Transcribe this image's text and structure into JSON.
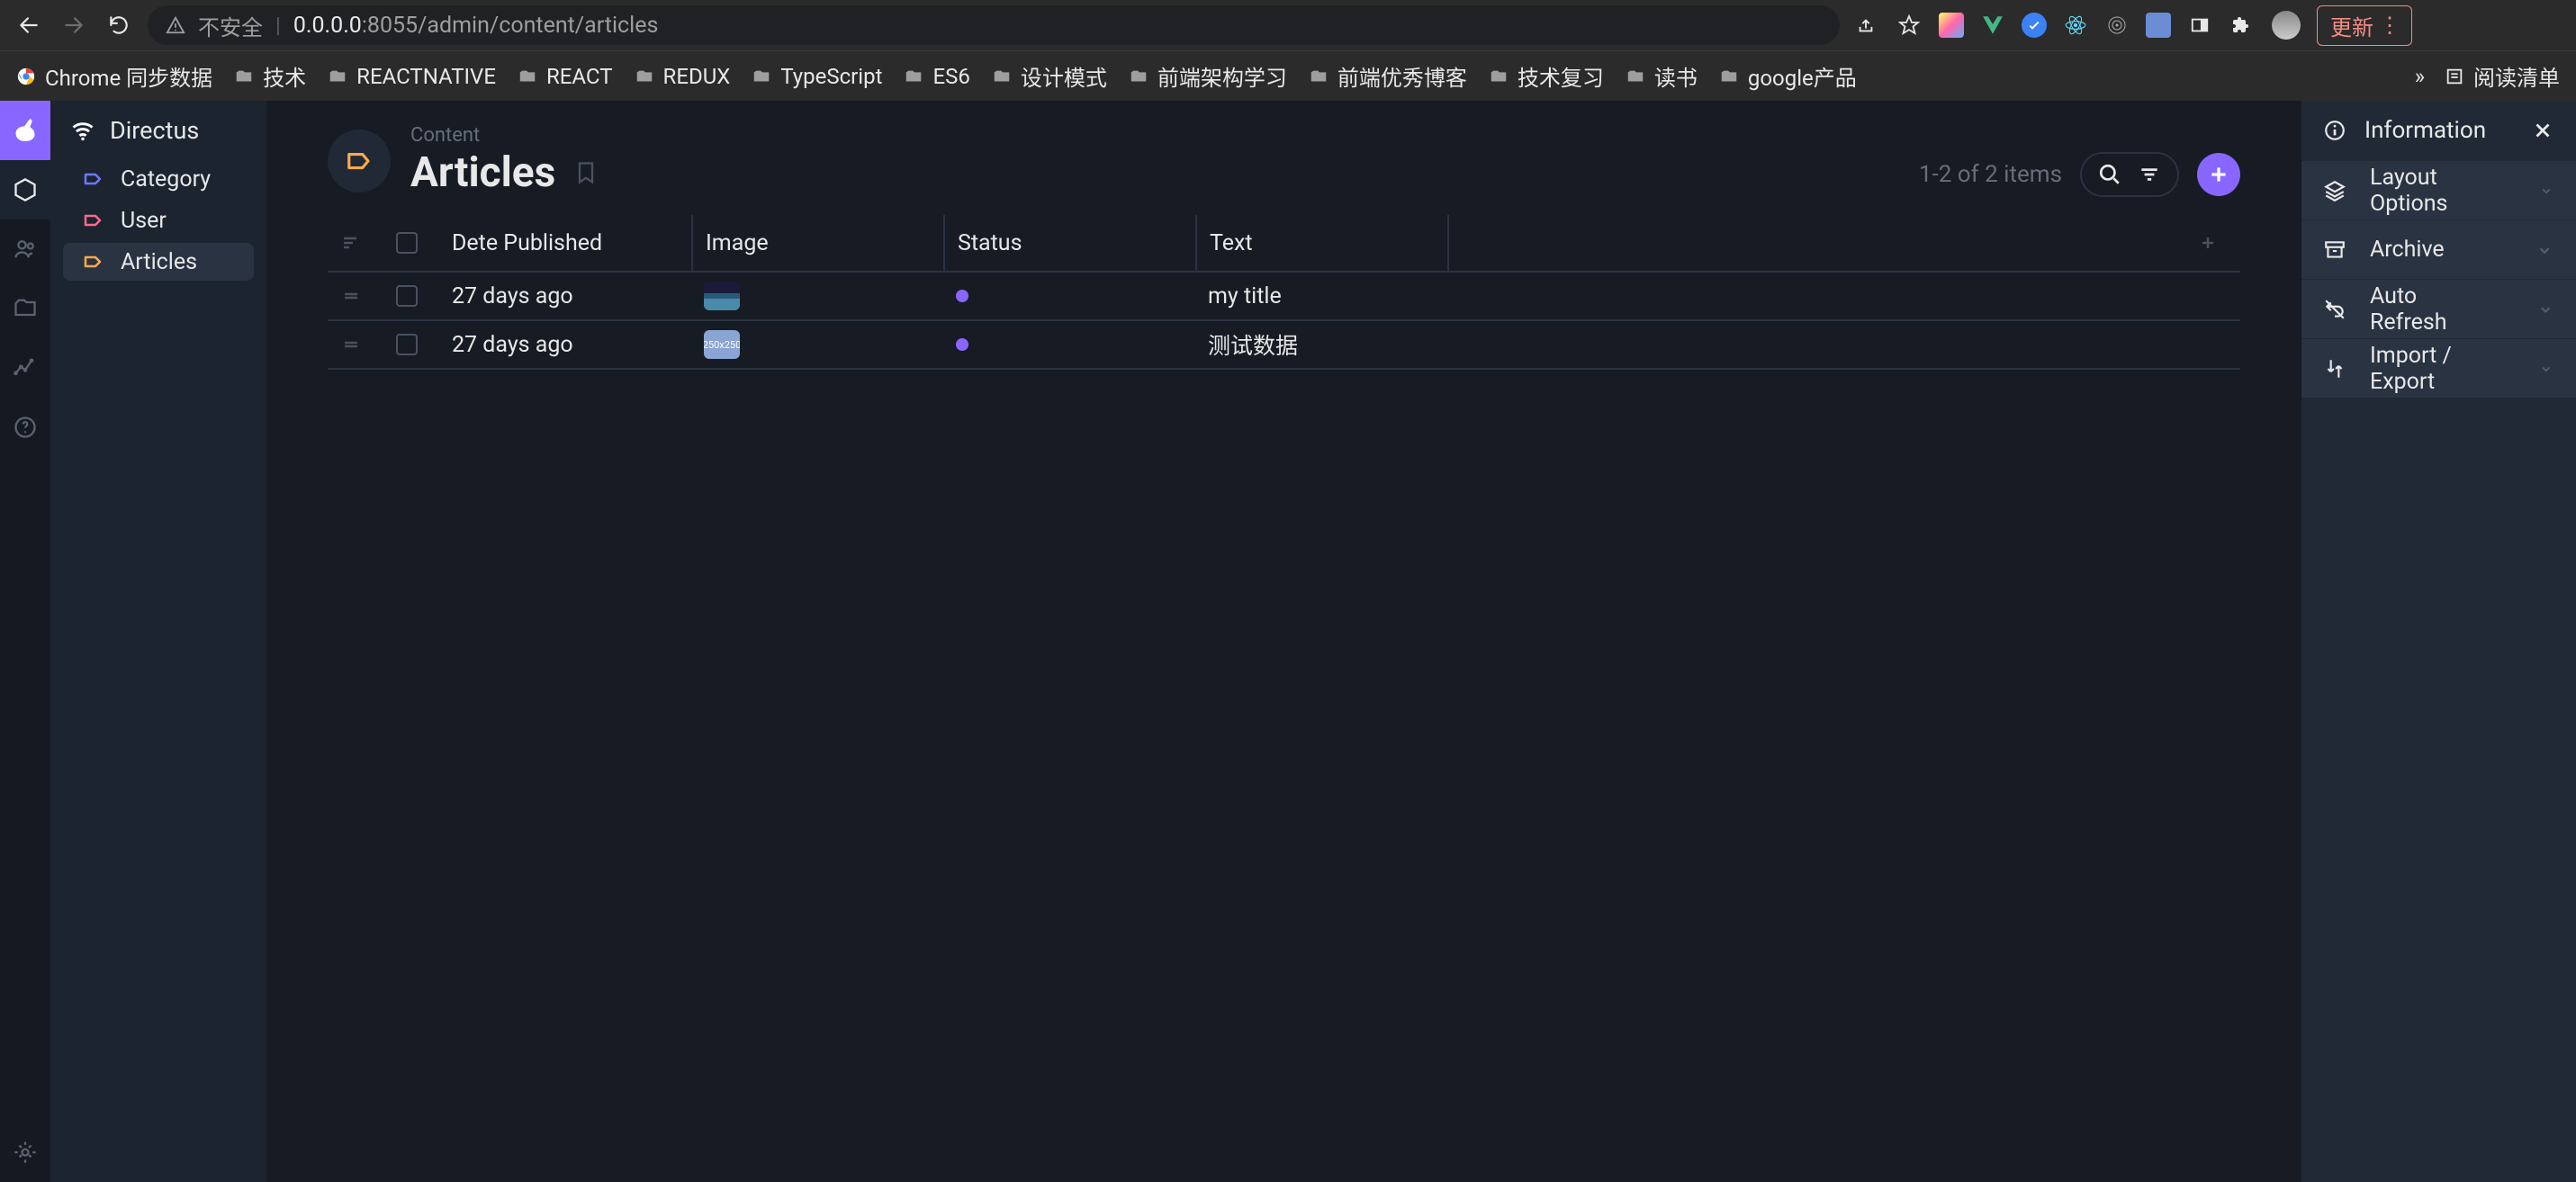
{
  "browser": {
    "insecure_label": "不安全",
    "domain": "0.0.0.0",
    "port_path": ":8055/admin/content/articles",
    "update_label": "更新",
    "bookmarks_more": "»",
    "reading_list": "阅读清单",
    "bookmarks": [
      {
        "label": "Chrome 同步数据",
        "type": "chrome"
      },
      {
        "label": "技术",
        "type": "folder"
      },
      {
        "label": "REACTNATIVE",
        "type": "folder"
      },
      {
        "label": "REACT",
        "type": "folder"
      },
      {
        "label": "REDUX",
        "type": "folder"
      },
      {
        "label": "TypeScript",
        "type": "folder"
      },
      {
        "label": "ES6",
        "type": "folder"
      },
      {
        "label": "设计模式",
        "type": "folder"
      },
      {
        "label": "前端架构学习",
        "type": "folder"
      },
      {
        "label": "前端优秀博客",
        "type": "folder"
      },
      {
        "label": "技术复习",
        "type": "folder"
      },
      {
        "label": "读书",
        "type": "folder"
      },
      {
        "label": "google产品",
        "type": "folder"
      }
    ]
  },
  "sidebar": {
    "brand": "Directus",
    "items": [
      {
        "label": "Category",
        "color": "#6a7aff"
      },
      {
        "label": "User",
        "color": "#ff6a8a"
      },
      {
        "label": "Articles",
        "color": "#ffaa4a"
      }
    ]
  },
  "header": {
    "breadcrumb": "Content",
    "title": "Articles",
    "count": "1-2 of 2 items"
  },
  "table": {
    "columns": [
      "Dete Published",
      "Image",
      "Status",
      "Text"
    ],
    "rows": [
      {
        "date": "27 days ago",
        "text": "my title",
        "thumb_label": ""
      },
      {
        "date": "27 days ago",
        "text": "测试数据",
        "thumb_label": "250x250"
      }
    ]
  },
  "panel": {
    "header": "Information",
    "items": [
      {
        "icon": "layout",
        "label": "Layout Options"
      },
      {
        "icon": "archive",
        "label": "Archive"
      },
      {
        "icon": "refresh",
        "label": "Auto Refresh"
      },
      {
        "icon": "import",
        "label": "Import / Export"
      }
    ]
  }
}
